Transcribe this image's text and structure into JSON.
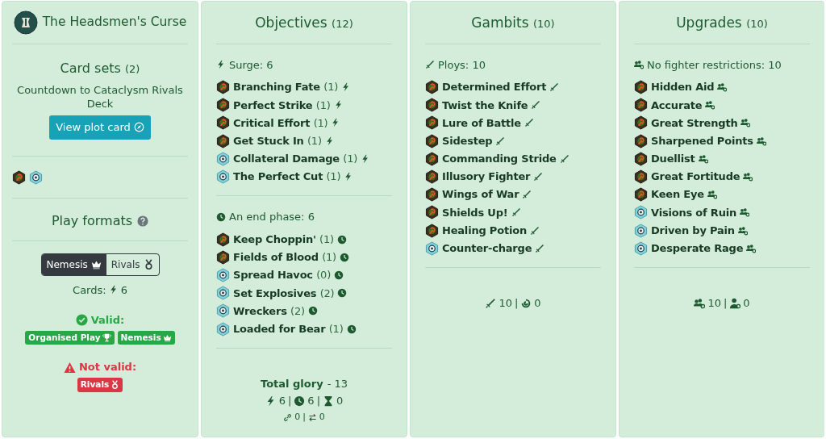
{
  "deck": {
    "title": "The Headsmen's Curse",
    "card_sets": {
      "title": "Card sets",
      "count": "(2)",
      "description": "Countdown to Cataclysm Rivals Deck",
      "button": "View plot card"
    },
    "set_icons": [
      {
        "kind": "rivals"
      },
      {
        "kind": "universal"
      }
    ],
    "play_formats": {
      "title": "Play formats",
      "options": [
        {
          "label": "Nemesis",
          "kind": "crown",
          "selected": true
        },
        {
          "label": "Rivals",
          "kind": "medal",
          "selected": false
        }
      ],
      "cards_label": "Cards:",
      "cards_value": "6",
      "valid_label": "Valid:",
      "valid": [
        {
          "label": "Organised Play",
          "kind": "trophy"
        },
        {
          "label": "Nemesis",
          "kind": "crown"
        }
      ],
      "invalid_label": "Not valid:",
      "invalid": [
        {
          "label": "Rivals",
          "kind": "medal"
        }
      ]
    }
  },
  "sections": [
    {
      "title": "Objectives",
      "count": "(12)",
      "groups": [
        {
          "kind": "surge",
          "label": "Surge: 6",
          "cards": [
            {
              "name": "Branching Fate",
              "glory": "(1)",
              "kind": "rivals"
            },
            {
              "name": "Perfect Strike",
              "glory": "(1)",
              "kind": "rivals"
            },
            {
              "name": "Critical Effort",
              "glory": "(1)",
              "kind": "rivals"
            },
            {
              "name": "Get Stuck In",
              "glory": "(1)",
              "kind": "rivals"
            },
            {
              "name": "Collateral Damage",
              "glory": "(1)",
              "kind": "universal"
            },
            {
              "name": "The Perfect Cut",
              "glory": "(1)",
              "kind": "universal"
            }
          ]
        },
        {
          "kind": "end",
          "label": "An end phase: 6",
          "cards": [
            {
              "name": "Keep Choppin'",
              "glory": "(1)",
              "kind": "rivals"
            },
            {
              "name": "Fields of Blood",
              "glory": "(1)",
              "kind": "rivals"
            },
            {
              "name": "Spread Havoc",
              "glory": "(0)",
              "kind": "universal"
            },
            {
              "name": "Set Explosives",
              "glory": "(2)",
              "kind": "universal"
            },
            {
              "name": "Wreckers",
              "glory": "(2)",
              "kind": "universal"
            },
            {
              "name": "Loaded for Bear",
              "glory": "(1)",
              "kind": "universal"
            }
          ]
        }
      ],
      "summary": {
        "total_label": "Total glory",
        "total_value": "- 13",
        "separator": "|",
        "rows": [
          [
            {
              "kind": "surge",
              "value": "6"
            },
            {
              "kind": "end",
              "value": "6"
            },
            {
              "kind": "hourglass",
              "value": "0"
            }
          ],
          [
            {
              "kind": "link",
              "value": "0"
            },
            {
              "kind": "swap",
              "value": "0"
            }
          ]
        ]
      }
    },
    {
      "title": "Gambits",
      "count": "(10)",
      "groups": [
        {
          "kind": "ploy",
          "label": "Ploys: 10",
          "cards": [
            {
              "name": "Determined Effort",
              "kind": "rivals"
            },
            {
              "name": "Twist the Knife",
              "kind": "rivals"
            },
            {
              "name": "Lure of Battle",
              "kind": "rivals"
            },
            {
              "name": "Sidestep",
              "kind": "rivals"
            },
            {
              "name": "Commanding Stride",
              "kind": "rivals"
            },
            {
              "name": "Illusory Fighter",
              "kind": "rivals"
            },
            {
              "name": "Wings of War",
              "kind": "rivals"
            },
            {
              "name": "Shields Up!",
              "kind": "rivals"
            },
            {
              "name": "Healing Potion",
              "kind": "rivals"
            },
            {
              "name": "Counter-charge",
              "kind": "universal"
            }
          ]
        }
      ],
      "summary": {
        "separator": "|",
        "rows": [
          [
            {
              "kind": "ploy",
              "value": "10"
            },
            {
              "kind": "spell",
              "value": "0"
            }
          ]
        ]
      }
    },
    {
      "title": "Upgrades",
      "count": "(10)",
      "groups": [
        {
          "kind": "users",
          "label": "No fighter restrictions: 10",
          "cards": [
            {
              "name": "Hidden Aid",
              "kind": "rivals"
            },
            {
              "name": "Accurate",
              "kind": "rivals"
            },
            {
              "name": "Great Strength",
              "kind": "rivals"
            },
            {
              "name": "Sharpened Points",
              "kind": "rivals"
            },
            {
              "name": "Duellist",
              "kind": "rivals"
            },
            {
              "name": "Great Fortitude",
              "kind": "rivals"
            },
            {
              "name": "Keen Eye",
              "kind": "rivals"
            },
            {
              "name": "Visions of Ruin",
              "kind": "universal"
            },
            {
              "name": "Driven by Pain",
              "kind": "universal"
            },
            {
              "name": "Desperate Rage",
              "kind": "universal"
            }
          ]
        }
      ],
      "summary": {
        "separator": "|",
        "rows": [
          [
            {
              "kind": "users",
              "value": "10"
            },
            {
              "kind": "user",
              "value": "0"
            }
          ]
        ]
      }
    }
  ]
}
